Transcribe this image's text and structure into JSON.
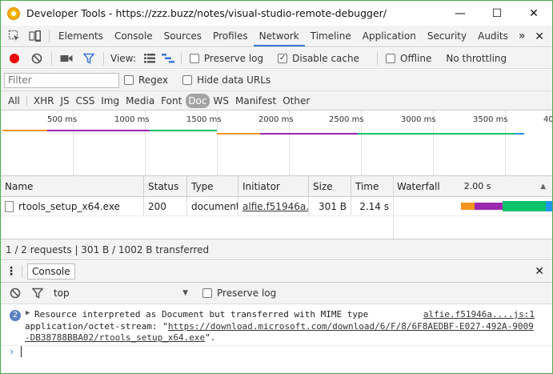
{
  "window": {
    "title": "Developer Tools - https://zzz.buzz/notes/visual-studio-remote-debugger/",
    "controls": {
      "minimize": "—",
      "maximize": "☐",
      "close": "✕"
    }
  },
  "tabs": [
    "Elements",
    "Console",
    "Sources",
    "Profiles",
    "Network",
    "Timeline",
    "Application",
    "Security",
    "Audits"
  ],
  "active_tab": "Network",
  "more_tabs": "»",
  "toolbar": {
    "view_label": "View:",
    "preserve_log": "Preserve log",
    "disable_cache": "Disable cache",
    "disable_cache_checked": true,
    "offline": "Offline",
    "throttling": "No throttling"
  },
  "filter": {
    "placeholder": "Filter",
    "regex": "Regex",
    "hide_data_urls": "Hide data URLs",
    "types": [
      "All",
      "XHR",
      "JS",
      "CSS",
      "Img",
      "Media",
      "Font",
      "Doc",
      "WS",
      "Manifest",
      "Other"
    ],
    "active_type": "Doc"
  },
  "overview": {
    "ticks": [
      "500 ms",
      "1000 ms",
      "1500 ms",
      "2000 ms",
      "2500 ms",
      "3000 ms",
      "3500 ms",
      "40"
    ]
  },
  "table": {
    "columns": [
      "Name",
      "Status",
      "Type",
      "Initiator",
      "Size",
      "Time",
      "Waterfall"
    ],
    "waterfall_marker": "2.00 s",
    "rows": [
      {
        "name": "rtools_setup_x64.exe",
        "status": "200",
        "type": "document",
        "initiator": "alfie.f51946a....",
        "size": "301 B",
        "time": "2.14 s"
      }
    ]
  },
  "summary": "1 / 2 requests  |  301 B / 1002 B transferred",
  "drawer": {
    "tab": "Console",
    "context": "top",
    "preserve_log": "Preserve log"
  },
  "console": {
    "count": "2",
    "line1": "Resource interpreted as Document but transferred with MIME type",
    "line2_prefix": "application/octet-stream: \"",
    "line2_link": "https://download.microsoft.com/download/6/F/8/6F8AEDBF-E027-492A-9009",
    "line3_link": "-DB38788BBA02/rtools_setup_x64.exe",
    "line3_suffix": "\".",
    "source": "alfie.f51946a....js:1",
    "prompt": "›"
  },
  "colors": {
    "accent": "#3879d9",
    "record": "#e00000",
    "bar_orange": "#f7931e",
    "bar_purple": "#9c27b0",
    "bar_green": "#0cc26b",
    "bar_blue": "#2196f3",
    "window_border": "#4caf50"
  }
}
